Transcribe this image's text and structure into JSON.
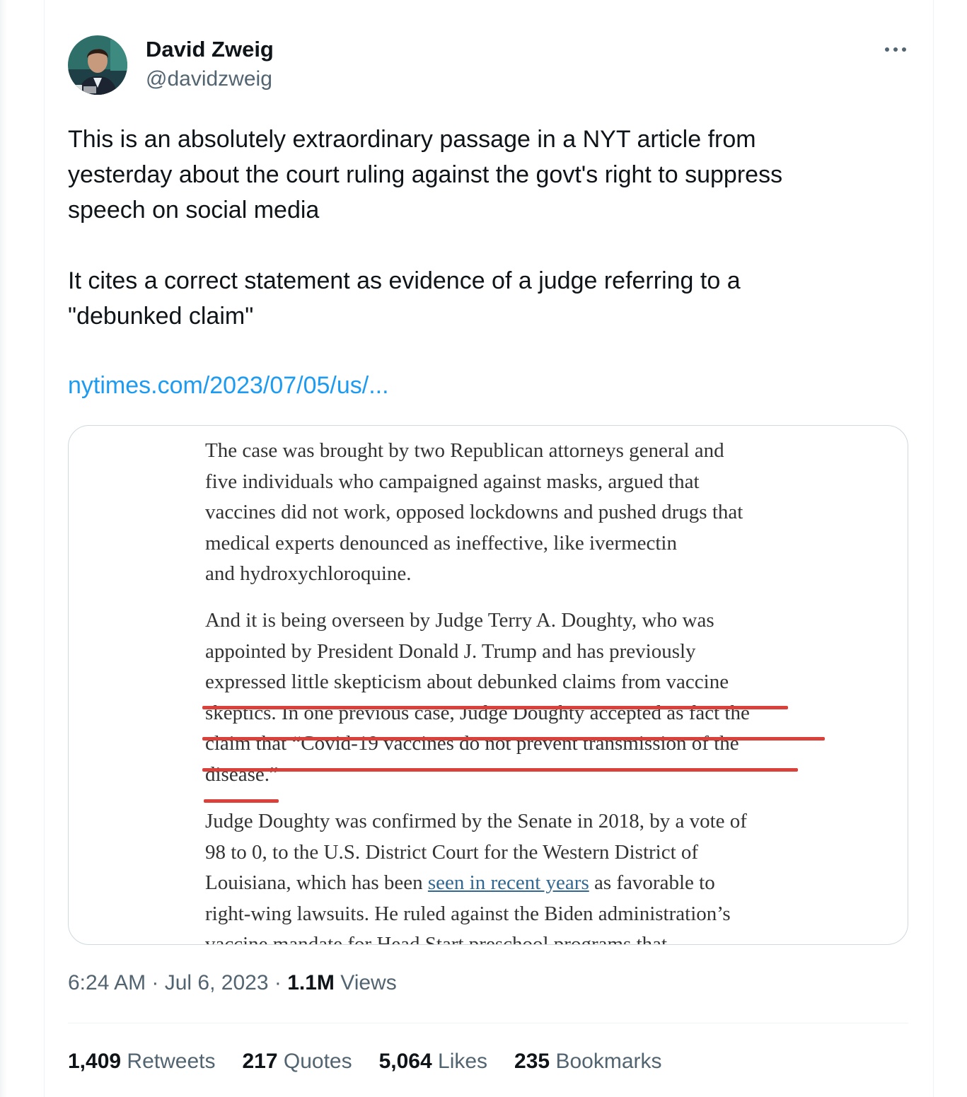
{
  "author": {
    "name": "David Zweig",
    "handle": "@davidzweig"
  },
  "tweet": {
    "text": "This is an absolutely extraordinary passage in a NYT article from\nyesterday about the court ruling against the govt's right to suppress\nspeech on social media\n\nIt cites a correct statement as evidence of a judge referring to a\n\"debunked claim\"",
    "link": "nytimes.com/2023/07/05/us/..."
  },
  "article": {
    "para1": [
      "The case was brought by two Republican attorneys general and",
      "five individuals who campaigned against masks, argued that",
      "vaccines did not work, opposed lockdowns and pushed drugs that",
      "medical experts denounced as ineffective, like ivermectin",
      "and hydroxychloroquine."
    ],
    "para2": [
      "And it is being overseen by Judge Terry A. Doughty, who was",
      "appointed by President Donald J. Trump and has previously",
      "expressed little skepticism about debunked claims from vaccine",
      "skeptics. In one previous case, Judge Doughty accepted as fact the",
      "claim that “Covid-19 vaccines do not prevent transmission of the",
      "disease.”"
    ],
    "para3": [
      "Judge Doughty was confirmed by the Senate in 2018, by a vote of",
      "98 to 0, to the U.S. District Court for the Western District of"
    ],
    "para3_line3_before": "Louisiana, which has been ",
    "para3_line3_link": "seen in recent years",
    "para3_line3_after": " as favorable to",
    "para3_line4": "right-wing lawsuits. He ruled against the Biden administration’s",
    "para3_line5_partial": "vaccine mandate for Head Start preschool programs that",
    "highlight_color": "#d9413a",
    "link_color": "#326891"
  },
  "meta": {
    "time": "6:24 AM",
    "sep1": " · ",
    "date": "Jul 6, 2023",
    "sep2": " · ",
    "views_count": "1.1M",
    "views_label": " Views"
  },
  "stats": {
    "retweets_count": "1,409",
    "retweets_label": " Retweets",
    "quotes_count": "217",
    "quotes_label": " Quotes",
    "likes_count": "5,064",
    "likes_label": " Likes",
    "bookmarks_count": "235",
    "bookmarks_label": " Bookmarks"
  },
  "colors": {
    "link": "#1d9bf0",
    "secondary_text": "#536471",
    "primary_text": "#0f1419"
  },
  "icons": {
    "more": "more-horizontal-icon"
  }
}
